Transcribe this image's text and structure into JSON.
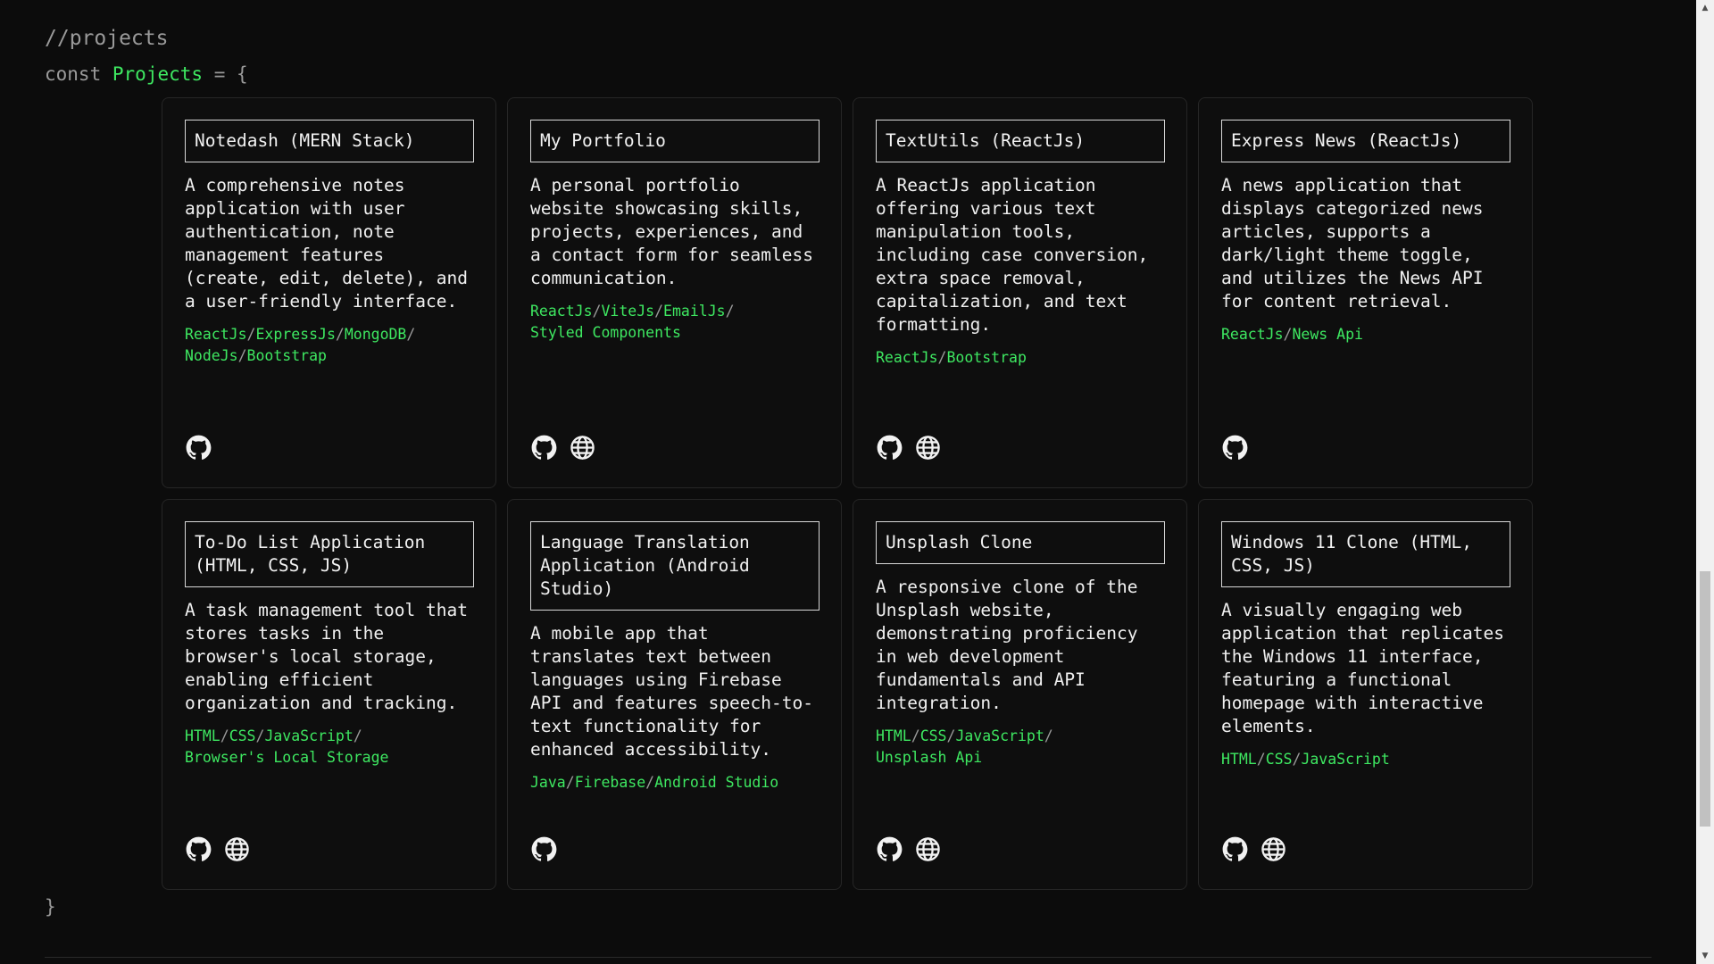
{
  "header": {
    "comment": "//projects",
    "decl_keyword": "const",
    "decl_name": "Projects",
    "decl_op": "= {",
    "closing": "}"
  },
  "colors": {
    "accent": "#3ee861",
    "background": "#0c0c0c",
    "text": "#f0f0f0"
  },
  "projects": [
    {
      "title": "Notedash (MERN Stack)",
      "description": "A comprehensive notes application with user authentication, note management features (create, edit, delete), and a user-friendly interface.",
      "tech": [
        "ReactJs",
        "ExpressJs",
        "MongoDB",
        "NodeJs",
        "Bootstrap"
      ],
      "tech_lines": [
        [
          "ReactJs",
          "ExpressJs",
          "MongoDB",
          ""
        ],
        [
          "NodeJs",
          "Bootstrap"
        ]
      ],
      "icons": [
        "github-icon"
      ]
    },
    {
      "title": "My Portfolio",
      "description": "A personal portfolio website showcasing skills, projects, experiences, and a contact form for seamless communication.",
      "tech": [
        "ReactJs",
        "ViteJs",
        "EmailJs",
        "Styled Components"
      ],
      "tech_lines": [
        [
          "ReactJs",
          "ViteJs",
          "EmailJs",
          ""
        ],
        [
          "Styled Components"
        ]
      ],
      "icons": [
        "github-icon",
        "globe-icon"
      ]
    },
    {
      "title": "TextUtils (ReactJs)",
      "description": "A ReactJs application offering various text manipulation tools, including case conversion, extra space removal, capitalization, and text formatting.",
      "tech": [
        "ReactJs",
        "Bootstrap"
      ],
      "tech_lines": [
        [
          "ReactJs",
          "Bootstrap"
        ]
      ],
      "icons": [
        "github-icon",
        "globe-icon"
      ]
    },
    {
      "title": "Express News (ReactJs)",
      "description": "A news application that displays categorized news articles, supports a dark/light theme toggle, and utilizes the News API for content retrieval.",
      "tech": [
        "ReactJs",
        "News Api"
      ],
      "tech_lines": [
        [
          "ReactJs",
          "News Api"
        ]
      ],
      "icons": [
        "github-icon"
      ]
    },
    {
      "title": "To-Do List Application (HTML, CSS, JS)",
      "description": "A task management tool that stores tasks in the browser's local storage, enabling efficient organization and tracking.",
      "tech": [
        "HTML",
        "CSS",
        "JavaScript",
        "Browser's Local Storage"
      ],
      "tech_lines": [
        [
          "HTML",
          "CSS",
          "JavaScript",
          ""
        ],
        [
          "Browser's Local Storage"
        ]
      ],
      "icons": [
        "github-icon",
        "globe-icon"
      ]
    },
    {
      "title": "Language Translation Application (Android Studio)",
      "description": "A mobile app that translates text between languages using Firebase API and features speech-to-text functionality for enhanced accessibility.",
      "tech": [
        "Java",
        "Firebase",
        "Android Studio"
      ],
      "tech_lines": [
        [
          "Java",
          "Firebase",
          "Android Studio"
        ]
      ],
      "icons": [
        "github-icon"
      ]
    },
    {
      "title": "Unsplash Clone",
      "description": "A responsive clone of the Unsplash website, demonstrating proficiency in web development fundamentals and API integration.",
      "tech": [
        "HTML",
        "CSS",
        "JavaScript",
        "Unsplash Api"
      ],
      "tech_lines": [
        [
          "HTML",
          "CSS",
          "JavaScript",
          ""
        ],
        [
          "Unsplash Api"
        ]
      ],
      "icons": [
        "github-icon",
        "globe-icon"
      ]
    },
    {
      "title": "Windows 11 Clone (HTML, CSS, JS)",
      "description": "A visually engaging web application that replicates the Windows 11 interface, featuring a functional homepage with interactive elements.",
      "tech": [
        "HTML",
        "CSS",
        "JavaScript"
      ],
      "tech_lines": [
        [
          "HTML",
          "CSS",
          "JavaScript"
        ]
      ],
      "icons": [
        "github-icon",
        "globe-icon"
      ]
    }
  ],
  "scrollbar": {
    "up_arrow": "▲",
    "down_arrow": "▼",
    "scroll_position": 0.82
  }
}
